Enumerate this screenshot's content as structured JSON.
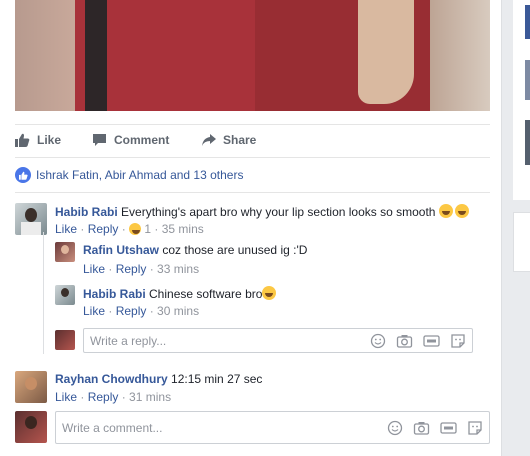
{
  "actions": {
    "like": "Like",
    "comment": "Comment",
    "share": "Share"
  },
  "likes": {
    "summary": "Ishrak Fatin, Abir Ahmad and 13 others"
  },
  "comments": [
    {
      "name": "Habib Rabi",
      "text": "Everything's apart bro why your lip section looks so smooth",
      "emojis": "😂😂",
      "like": "Like",
      "reply": "Reply",
      "reaction_count": "1",
      "time": "35 mins",
      "replies": [
        {
          "name": "Rafin Utshaw",
          "text": "coz those are unused ig :'D",
          "like": "Like",
          "reply": "Reply",
          "time": "33 mins"
        },
        {
          "name": "Habib Rabi",
          "text": "Chinese software bro",
          "like": "Like",
          "reply": "Reply",
          "time": "30 mins"
        }
      ],
      "reply_placeholder": "Write a reply..."
    },
    {
      "name": "Rayhan Chowdhury",
      "text": "12:15 min 27 sec",
      "like": "Like",
      "reply": "Reply",
      "time": "31 mins"
    }
  ],
  "composer": {
    "placeholder": "Write a comment..."
  },
  "colors": {
    "link": "#365899",
    "meta": "#90949c",
    "accent": "#4a76e8"
  },
  "icons": {
    "like": "thumbs-up-icon",
    "comment": "speech-bubble-icon",
    "share": "share-arrow-icon",
    "emoji": "smiley-icon",
    "camera": "camera-icon",
    "gif": "gif-icon",
    "sticker": "sticker-icon"
  }
}
